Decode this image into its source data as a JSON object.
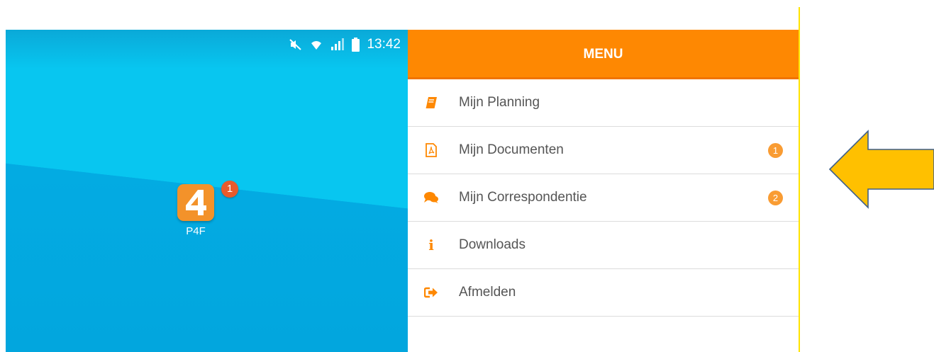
{
  "phone": {
    "status_time": "13:42",
    "status_icons": [
      "mute-icon",
      "wifi-icon",
      "signal-icon",
      "battery-icon"
    ],
    "app": {
      "label": "P4F",
      "icon_glyph": "4",
      "badge": "1"
    }
  },
  "menu": {
    "title": "MENU",
    "items": [
      {
        "icon": "book-icon",
        "label": "Mijn Planning",
        "badge": ""
      },
      {
        "icon": "pdf-document-icon",
        "label": "Mijn Documenten",
        "badge": "1"
      },
      {
        "icon": "chat-bubbles-icon",
        "label": "Mijn Correspondentie",
        "badge": "2"
      },
      {
        "icon": "info-icon",
        "label": "Downloads",
        "badge": ""
      },
      {
        "icon": "sign-out-icon",
        "label": "Afmelden",
        "badge": ""
      }
    ]
  },
  "colors": {
    "menu_header": "#fe8802",
    "wallpaper": "#07c7f1",
    "arrow": "#ffc000",
    "arrow_outline": "#3e5f8a",
    "divider": "#ffe400"
  }
}
